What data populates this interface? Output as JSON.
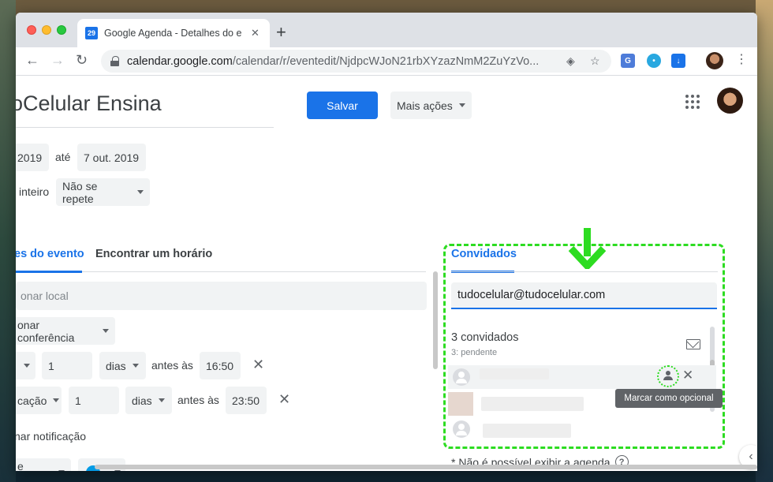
{
  "browser": {
    "tab_title": "Google Agenda - Detalhes do e",
    "tab_favicon_text": "29",
    "tab_close": "✕",
    "new_tab": "+",
    "url_host": "calendar.google.com",
    "url_path": "/calendar/r/eventedit/NjdpcWJoN21rbXYzazNmM2ZuYzVo..."
  },
  "header": {
    "event_title": "oCelular Ensina",
    "save_label": "Salvar",
    "more_actions_label": "Mais ações"
  },
  "datetime": {
    "start_date": "2019",
    "until_label": "até",
    "end_date": "7 out. 2019",
    "all_day_label": "inteiro",
    "repeat_label": "Não se repete"
  },
  "tabs": {
    "details": "es do evento",
    "find_time": "Encontrar um horário"
  },
  "details": {
    "location_placeholder": "onar local",
    "conference_label": "onar conferência",
    "notif1_value": "1",
    "notif1_unit": "dias",
    "notif1_before": "antes às",
    "notif1_time": "16:50",
    "notif2_type": "cação",
    "notif2_value": "1",
    "notif2_unit": "dias",
    "notif2_before": "antes às",
    "notif2_time": "23:50",
    "add_notification": "nar notificação",
    "owner": "e Farias"
  },
  "guests": {
    "tab_label": "Convidados",
    "input_value": "tudocelular@tudocelular.com",
    "count_label": "3 convidados",
    "pending_label": "3: pendente",
    "tooltip": "Marcar como opcional",
    "cant_show": "* Não é possível exibir a agenda",
    "help": "?"
  },
  "colors": {
    "accent": "#1a73e8",
    "highlight": "#2ddc21"
  }
}
